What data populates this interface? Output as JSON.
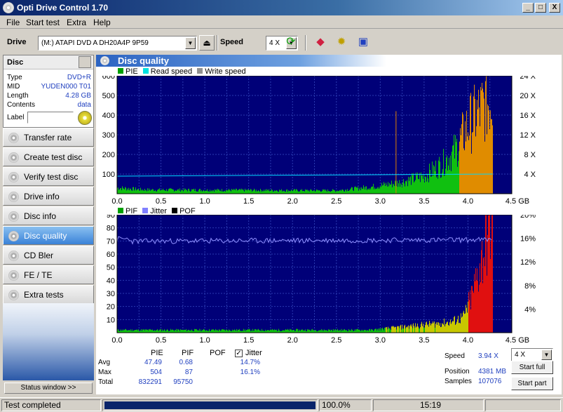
{
  "window": {
    "title": "Opti Drive Control 1.70",
    "buttons": [
      "_",
      "□",
      "X"
    ]
  },
  "menu": [
    "File",
    "Start test",
    "Extra",
    "Help"
  ],
  "toolbar": {
    "drive_label": "Drive",
    "drive_value": "(M:)   ATAPI DVD A  DH20A4P 9P59",
    "speed_label": "Speed",
    "speed_value": "4 X"
  },
  "disc": {
    "header": "Disc",
    "rows": [
      {
        "k": "Type",
        "v": "DVD+R"
      },
      {
        "k": "MID",
        "v": "YUDEN000 T01"
      },
      {
        "k": "Length",
        "v": "4.28 GB"
      },
      {
        "k": "Contents",
        "v": "data"
      }
    ],
    "label_caption": "Label"
  },
  "nav": [
    "Transfer rate",
    "Create test disc",
    "Verify test disc",
    "Drive info",
    "Disc info",
    "Disc quality",
    "CD Bler",
    "FE / TE",
    "Extra tests"
  ],
  "nav_active": 5,
  "status_window": "Status window >>",
  "panel_title": "Disc quality",
  "chart_data": [
    {
      "type": "bar",
      "legend": [
        {
          "name": "PIE",
          "color": "#00a000"
        },
        {
          "name": "Read speed",
          "color": "#00e0e0"
        },
        {
          "name": "Write speed",
          "color": "#909090"
        }
      ],
      "x_ticks": [
        "0.0",
        "0.5",
        "1.0",
        "1.5",
        "2.0",
        "2.5",
        "3.0",
        "3.5",
        "4.0",
        "4.5 GB"
      ],
      "y_left_ticks": [
        "100",
        "200",
        "300",
        "400",
        "500",
        "600"
      ],
      "y_right_ticks": [
        "4 X",
        "8 X",
        "12 X",
        "16 X",
        "20 X",
        "24 X"
      ],
      "xlim": [
        0,
        4.5
      ],
      "ylim": [
        0,
        600
      ],
      "y2lim": [
        0,
        24
      ],
      "pie_profile": [
        [
          0,
          30
        ],
        [
          0.3,
          20
        ],
        [
          2.5,
          16
        ],
        [
          2.9,
          35
        ],
        [
          3.2,
          55
        ],
        [
          3.5,
          90
        ],
        [
          3.7,
          150
        ],
        [
          3.85,
          220
        ],
        [
          4.0,
          350
        ],
        [
          4.15,
          430
        ],
        [
          4.28,
          500
        ]
      ],
      "read_speed_x": 4.0,
      "grid": true
    },
    {
      "type": "bar",
      "legend": [
        {
          "name": "PIF",
          "color": "#00a000"
        },
        {
          "name": "Jitter",
          "color": "#8080ff"
        },
        {
          "name": "POF",
          "color": "#000000"
        }
      ],
      "x_ticks": [
        "0.0",
        "0.5",
        "1.0",
        "1.5",
        "2.0",
        "2.5",
        "3.0",
        "3.5",
        "4.0",
        "4.5 GB"
      ],
      "y_left_ticks": [
        "10",
        "20",
        "30",
        "40",
        "50",
        "60",
        "70",
        "80",
        "90"
      ],
      "y_right_ticks": [
        "4%",
        "8%",
        "12%",
        "16%",
        "20%"
      ],
      "xlim": [
        0,
        4.5
      ],
      "ylim": [
        0,
        90
      ],
      "y2lim": [
        0,
        20
      ],
      "pif_profile": [
        [
          0,
          2
        ],
        [
          2.9,
          2
        ],
        [
          3.2,
          4
        ],
        [
          3.5,
          6
        ],
        [
          3.8,
          8
        ],
        [
          3.95,
          12
        ],
        [
          4.05,
          30
        ],
        [
          4.15,
          55
        ],
        [
          4.22,
          75
        ],
        [
          4.28,
          87
        ]
      ],
      "jitter_pct": 15.5,
      "grid": true
    }
  ],
  "stats": {
    "cols": [
      "PIE",
      "PIF",
      "POF",
      "Jitter"
    ],
    "jitter_checked": true,
    "rows": [
      {
        "label": "Avg",
        "pie": "47.49",
        "pif": "0.68",
        "pof": "",
        "jitter": "14.7%"
      },
      {
        "label": "Max",
        "pie": "504",
        "pif": "87",
        "pof": "",
        "jitter": "16.1%"
      },
      {
        "label": "Total",
        "pie": "832291",
        "pif": "95750",
        "pof": "",
        "jitter": ""
      }
    ],
    "speed_label": "Speed",
    "speed_value": "3.94 X",
    "speed_select": "4 X",
    "position_label": "Position",
    "position_value": "4381 MB",
    "samples_label": "Samples",
    "samples_value": "107076",
    "start_full": "Start full",
    "start_part": "Start part"
  },
  "statusbar": {
    "text": "Test completed",
    "progress": 100,
    "progress_text": "100.0%",
    "time": "15:19"
  }
}
